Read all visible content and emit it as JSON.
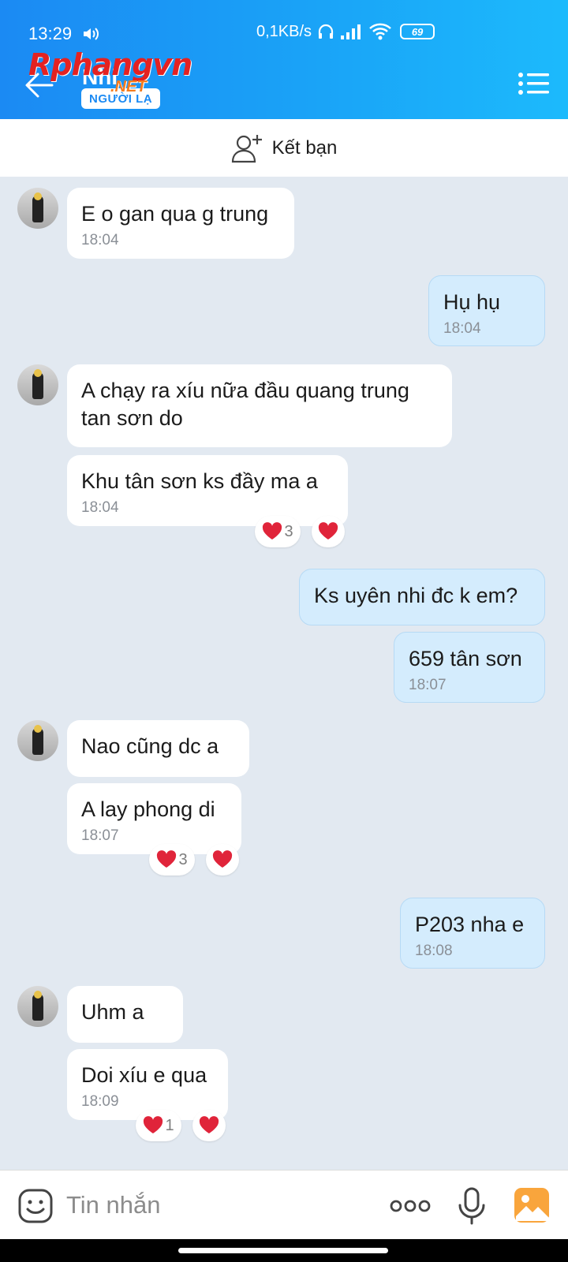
{
  "status_bar": {
    "time": "13:29",
    "network_speed": "0,1KB/s",
    "battery": "69"
  },
  "header": {
    "contact_name": "Nhi",
    "stranger_badge": "NGƯỜI LẠ",
    "watermark": "Rphangvn",
    "watermark_suffix": ".NET"
  },
  "friend_bar": {
    "label": "Kết bạn"
  },
  "messages": [
    {
      "side": "in",
      "text": "E o gan qua g trung",
      "time": "18:04"
    },
    {
      "side": "out",
      "text": "Hụ hụ",
      "time": "18:04"
    },
    {
      "side": "in",
      "text": "A chạy ra xíu nữa đầu quang trung tan sơn do",
      "time": ""
    },
    {
      "side": "in",
      "text": "Khu tân sơn ks đầy ma a",
      "time": "18:04",
      "reaction_count": "3"
    },
    {
      "side": "out",
      "text": "Ks uyên nhi đc k em?",
      "time": ""
    },
    {
      "side": "out",
      "text": "659 tân sơn",
      "time": "18:07"
    },
    {
      "side": "in",
      "text": "Nao cũng dc a",
      "time": ""
    },
    {
      "side": "in",
      "text": "A lay phong di",
      "time": "18:07",
      "reaction_count": "3"
    },
    {
      "side": "out",
      "text": "P203 nha e",
      "time": "18:08"
    },
    {
      "side": "in",
      "text": "Uhm a",
      "time": ""
    },
    {
      "side": "in",
      "text": "Doi xíu e qua",
      "time": "18:09",
      "reaction_count": "1"
    }
  ],
  "composer": {
    "placeholder": "Tin nhắn"
  },
  "colors": {
    "header_blue": "#1b8af3",
    "outgoing_bubble": "#d4ecfd",
    "heart_red": "#e0243a"
  }
}
